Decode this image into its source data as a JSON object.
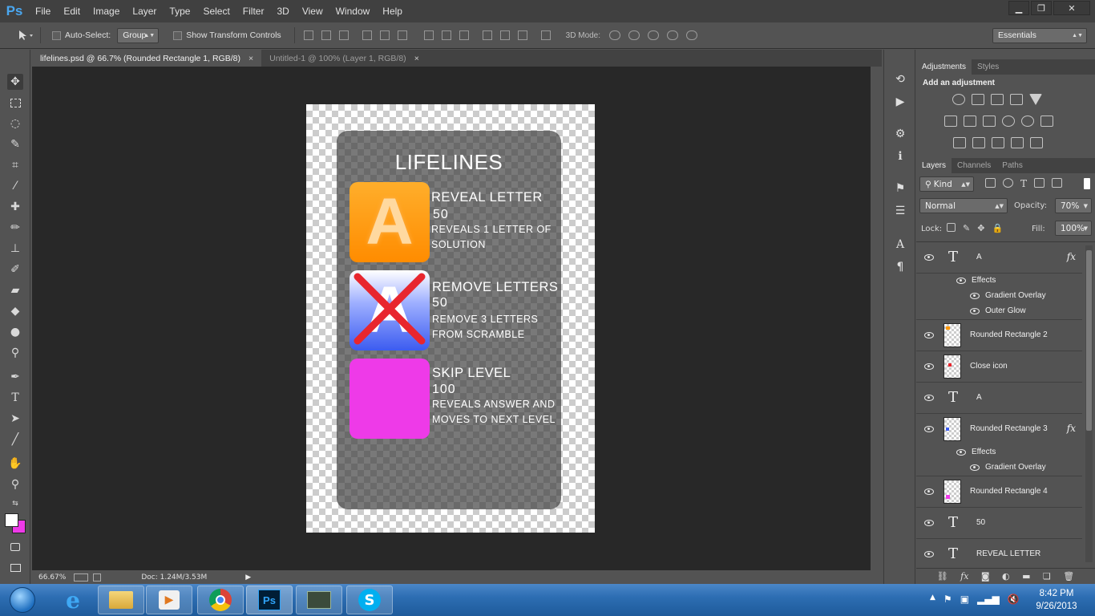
{
  "app": {
    "logo": "Ps"
  },
  "menu": [
    "File",
    "Edit",
    "Image",
    "Layer",
    "Type",
    "Select",
    "Filter",
    "3D",
    "View",
    "Window",
    "Help"
  ],
  "window_controls": {
    "minimize": "▁",
    "restore": "❐",
    "close": "✕"
  },
  "options": {
    "auto_select_label": "Auto-Select:",
    "auto_select_value": "Group",
    "show_transform_label": "Show Transform Controls",
    "mode3d_label": "3D Mode:",
    "workspace_value": "Essentials"
  },
  "tabs": [
    {
      "label": "lifelines.psd @ 66.7% (Rounded Rectangle 1, RGB/8)",
      "close": "×"
    },
    {
      "label": "Untitled-1 @ 100% (Layer 1, RGB/8)",
      "close": "×"
    }
  ],
  "canvas": {
    "title": "LIFELINES",
    "box_letter": "A",
    "items": [
      {
        "title": "REVEAL LETTER",
        "cost": "50",
        "desc1": "REVEALS 1 LETTER OF",
        "desc2": "SOLUTION"
      },
      {
        "title": "REMOVE LETTERS",
        "cost": "50",
        "desc1": "REMOVE 3 LETTERS",
        "desc2": "FROM SCRAMBLE"
      },
      {
        "title": "SKIP LEVEL",
        "cost": "100",
        "desc1": "REVEALS ANSWER AND",
        "desc2": "MOVES TO NEXT LEVEL"
      }
    ],
    "colors": {
      "orange": "#ff9800",
      "blue": "#3c5cf0",
      "magenta": "#ee3ae8",
      "cross": "#e8262e"
    }
  },
  "status": {
    "zoom": "66.67%",
    "doc": "Doc: 1.24M/3.53M"
  },
  "adjustments": {
    "tabs": [
      "Adjustments",
      "Styles"
    ],
    "heading": "Add an adjustment"
  },
  "layers_panel": {
    "tabs": [
      "Layers",
      "Channels",
      "Paths"
    ],
    "kind_label": "Kind",
    "blend_mode": "Normal",
    "opacity_label": "Opacity:",
    "opacity_value": "70%",
    "lock_label": "Lock:",
    "fill_label": "Fill:",
    "fill_value": "100%",
    "layers": [
      {
        "name": "A",
        "type": "text",
        "fx": "fx"
      },
      {
        "name": "Effects",
        "type": "effects"
      },
      {
        "name": "Gradient Overlay",
        "type": "effect"
      },
      {
        "name": "Outer Glow",
        "type": "effect"
      },
      {
        "name": "Rounded Rectangle 2",
        "type": "shape"
      },
      {
        "name": "Close icon",
        "type": "shape"
      },
      {
        "name": "A",
        "type": "text"
      },
      {
        "name": "Rounded Rectangle 3",
        "type": "shape",
        "fx": "fx"
      },
      {
        "name": "Effects",
        "type": "effects"
      },
      {
        "name": "Gradient Overlay",
        "type": "effect"
      },
      {
        "name": "Rounded Rectangle 4",
        "type": "shape"
      },
      {
        "name": "50",
        "type": "text"
      },
      {
        "name": "REVEAL LETTER",
        "type": "text"
      }
    ]
  },
  "taskbar": {
    "time": "8:42 PM",
    "date": "9/26/2013",
    "apps": [
      "start-orb",
      "internet-explorer",
      "windows-explorer",
      "media-player",
      "chrome",
      "photoshop",
      "terminal",
      "skype"
    ]
  }
}
